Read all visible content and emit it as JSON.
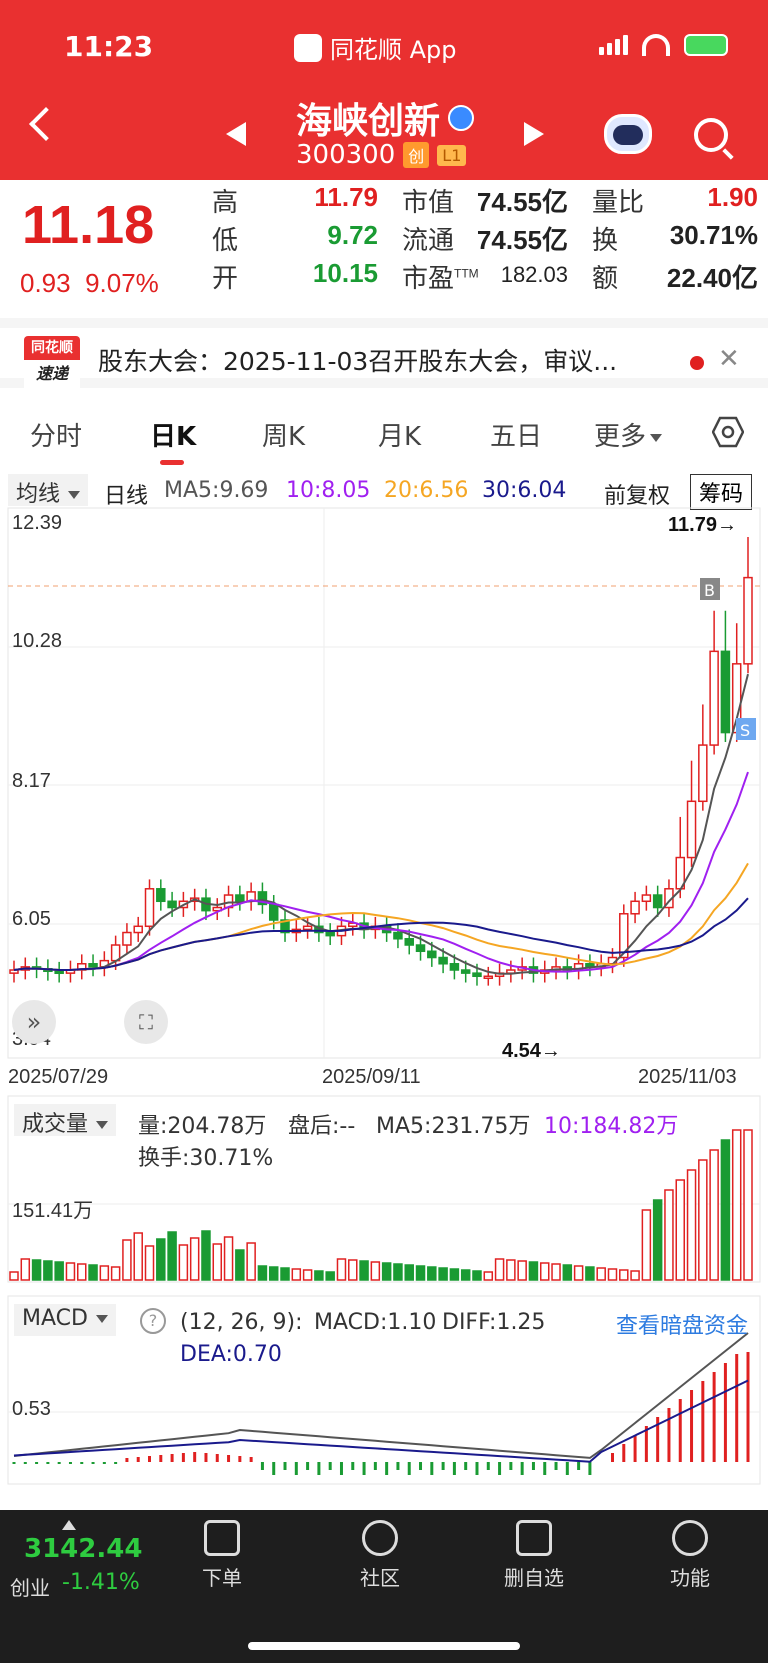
{
  "status_bar": {
    "time": "11:23",
    "app": "同花顺 App"
  },
  "header": {
    "name": "海峡创新",
    "code": "300300",
    "badge1": "创",
    "badge2": "L1"
  },
  "quote": {
    "price": "11.18",
    "change": "0.93",
    "pct": "9.07%",
    "high_label": "高",
    "high": "11.79",
    "low_label": "低",
    "low": "9.72",
    "open_label": "开",
    "open": "10.15",
    "mcap_label": "市值",
    "mcap": "74.55亿",
    "float_label": "流通",
    "float": "74.55亿",
    "pe_label": "市盈",
    "pe_sup": "TTM",
    "pe": "182.03",
    "vr_label": "量比",
    "vr": "1.90",
    "turn_label": "换",
    "turn": "30.71%",
    "amt_label": "额",
    "amt": "22.40亿"
  },
  "news": {
    "logo_top": "同花顺",
    "logo_bottom": "速递",
    "text": "股东大会：2025-11-03召开股东大会，审议..."
  },
  "tabs": [
    "分时",
    "日K",
    "周K",
    "月K",
    "五日",
    "更多"
  ],
  "ma_bar": {
    "dropdown": "均线",
    "period": "日线",
    "ma5": "MA5:9.69",
    "ma10": "10:8.05",
    "ma20": "20:6.56",
    "ma30": "30:6.04",
    "adjust": "前复权",
    "chip": "筹码"
  },
  "kchart": {
    "y_labels": [
      "12.39",
      "10.28",
      "8.17",
      "6.05",
      "3.94"
    ],
    "x_labels": [
      "2025/07/29",
      "2025/09/11",
      "2025/11/03"
    ],
    "high_mark": "11.79→",
    "low_mark": "4.54→",
    "b_mark": "B",
    "s_mark": "S"
  },
  "volume": {
    "dropdown": "成交量",
    "vol": "量:204.78万",
    "after": "盘后:--",
    "ma5": "MA5:231.75万",
    "ma10": "10:184.82万",
    "turnover": "换手:30.71%",
    "y_label": "151.41万"
  },
  "macd": {
    "dropdown": "MACD",
    "help": "?",
    "params": "(12, 26, 9):",
    "macd": "MACD:1.10",
    "diff": "DIFF:1.25",
    "dea": "DEA:0.70",
    "link": "查看暗盘资金",
    "y_label": "0.53"
  },
  "bottom_bar": {
    "index_value": "3142.44",
    "index_name": "创业",
    "index_change": "-1.41%",
    "items": [
      "下单",
      "社区",
      "删自选",
      "功能"
    ]
  },
  "colors": {
    "up": "#e02020",
    "down": "#1a9b33",
    "ma5": "#555555",
    "ma10": "#a020f0",
    "ma20": "#f5a623",
    "ma30": "#1a1a8c"
  }
}
